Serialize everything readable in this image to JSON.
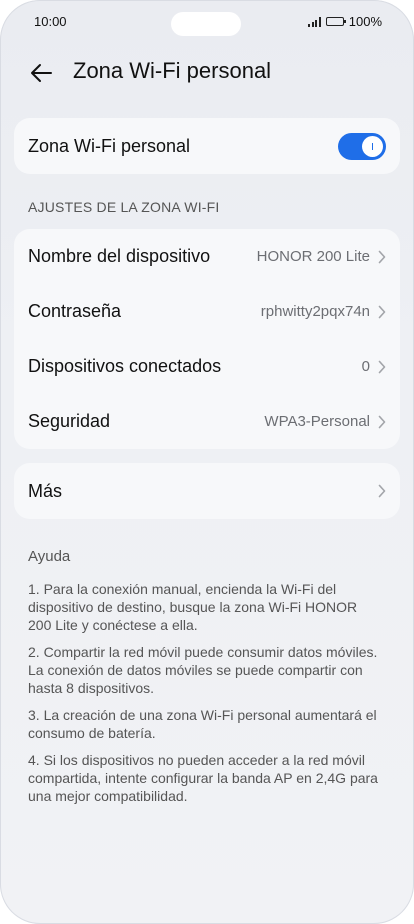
{
  "status_bar": {
    "time": "10:00",
    "battery": "100%"
  },
  "header": {
    "title": "Zona Wi-Fi personal",
    "back_icon": "arrow-left-icon"
  },
  "hotspot_toggle": {
    "label": "Zona Wi-Fi personal",
    "enabled": true,
    "color": "#1f6ee8"
  },
  "settings_section": {
    "title": "AJUSTES DE LA ZONA WI-FI",
    "rows": [
      {
        "label": "Nombre del dispositivo",
        "value": "HONOR 200 Lite"
      },
      {
        "label": "Contraseña",
        "value": "rphwitty2pqx74n"
      },
      {
        "label": "Dispositivos conectados",
        "value": "0"
      },
      {
        "label": "Seguridad",
        "value": "WPA3-Personal"
      }
    ]
  },
  "more": {
    "label": "Más"
  },
  "help": {
    "title": "Ayuda",
    "items": [
      "1. Para la conexión manual, encienda la Wi-Fi del dispositivo de destino, busque la zona Wi-Fi HONOR 200 Lite y conéctese a ella.",
      "2. Compartir la red móvil puede consumir datos móviles. La conexión de datos móviles se puede compartir con hasta 8 dispositivos.",
      "3. La creación de una zona Wi-Fi personal aumentará el consumo de batería.",
      "4. Si los dispositivos no pueden acceder a la red móvil compartida, intente configurar la banda AP en 2,4G para una mejor compatibilidad."
    ]
  }
}
